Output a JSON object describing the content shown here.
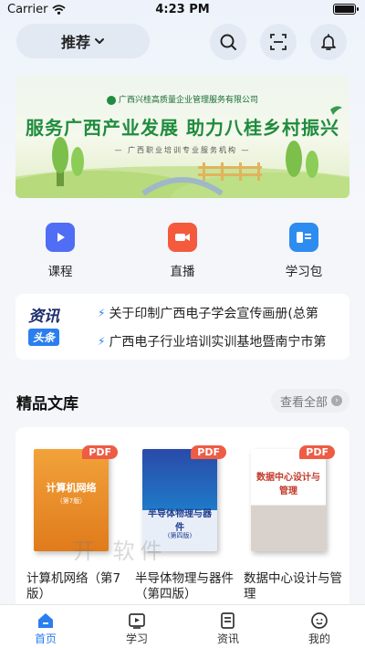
{
  "status_bar": {
    "carrier": "Carrier",
    "time": "4:23 PM"
  },
  "header": {
    "recommend_label": "推荐",
    "icons": [
      "search-icon",
      "scan-icon",
      "bell-icon"
    ]
  },
  "banner": {
    "org_name": "广西兴桂高质量企业管理服务有限公司",
    "slogan": "服务广西产业发展 助力八桂乡村振兴",
    "subtitle": "— 广西职业培训专业服务机构 —"
  },
  "quick_nav": [
    {
      "label": "课程",
      "icon": "play-icon",
      "color": "#4f6df5"
    },
    {
      "label": "直播",
      "icon": "live-camera-icon",
      "color": "#f45a3c"
    },
    {
      "label": "学习包",
      "icon": "study-pack-icon",
      "color": "#2d8cf0"
    }
  ],
  "news": {
    "logo_top": "资讯",
    "logo_bottom": "头条",
    "items": [
      "关于印制广西电子学会宣传画册(总第",
      "广西电子行业培训实训基地暨南宁市第"
    ]
  },
  "library": {
    "title": "精品文库",
    "see_all": "查看全部",
    "badge": "PDF",
    "books": [
      {
        "name": "计算机网络（第7版）",
        "cover_title": "计算机网络",
        "cover_edition": "（第7版）"
      },
      {
        "name": "半导体物理与器件（第四版）",
        "cover_title": "半导体物理与器件",
        "cover_edition": "(第四版)"
      },
      {
        "name": "数据中心设计与管理",
        "cover_title": "数据中心设计与管理",
        "cover_edition": ""
      }
    ]
  },
  "watermark": "开 软件",
  "tab_bar": {
    "tabs": [
      {
        "label": "首页",
        "active": true
      },
      {
        "label": "学习",
        "active": false
      },
      {
        "label": "资讯",
        "active": false
      },
      {
        "label": "我的",
        "active": false
      }
    ],
    "accent": "#2a7ef0"
  }
}
